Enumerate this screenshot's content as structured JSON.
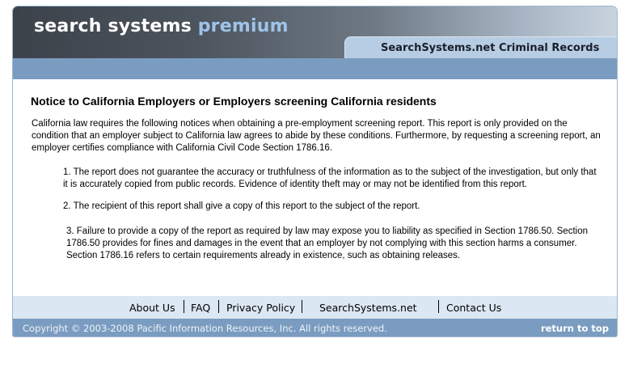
{
  "header": {
    "logo_word1": "search systems",
    "logo_word2": "premium",
    "tab_label": "SearchSystems.net Criminal Records"
  },
  "notice": {
    "heading": "Notice to California Employers or Employers screening California residents",
    "intro": "California law requires the following notices when obtaining a pre-employment screening report. This report is only provided on the condition that an employer subject to California law agrees to abide by these conditions. Furthermore, by requesting a screening report, an employer certifies compliance with California Civil Code Section 1786.16.",
    "items": [
      "1. The report does not guarantee the accuracy or truthfulness of the information as to the subject of the investigation, but only that it is accurately copied from public records. Evidence of identity theft may or may not be identified from this report.",
      "2. The recipient of this report shall give a copy of this report to the subject of the report.",
      "3. Failure to provide a copy of the report as required by law may expose you to liability as specified in Section 1786.50. Section 1786.50 provides for fines and damages in the event that an employer by not complying with this section harms a consumer. Section 1786.16 refers to certain requirements already in existence, such as obtaining releases."
    ]
  },
  "footer": {
    "links": [
      "About Us",
      "FAQ",
      "Privacy Policy",
      "SearchSystems.net",
      "Contact Us"
    ],
    "copyright": "Copyright © 2003-2008 Pacific Information Resources, Inc. All rights reserved.",
    "return_to_top": "return to top"
  },
  "colors": {
    "header_dark": "#3b424a",
    "tab_bg": "#b7cde3",
    "accent_bar": "#7a9cc0",
    "footer_nav_bg": "#dbe7f3",
    "logo_accent": "#9fc3ea"
  }
}
